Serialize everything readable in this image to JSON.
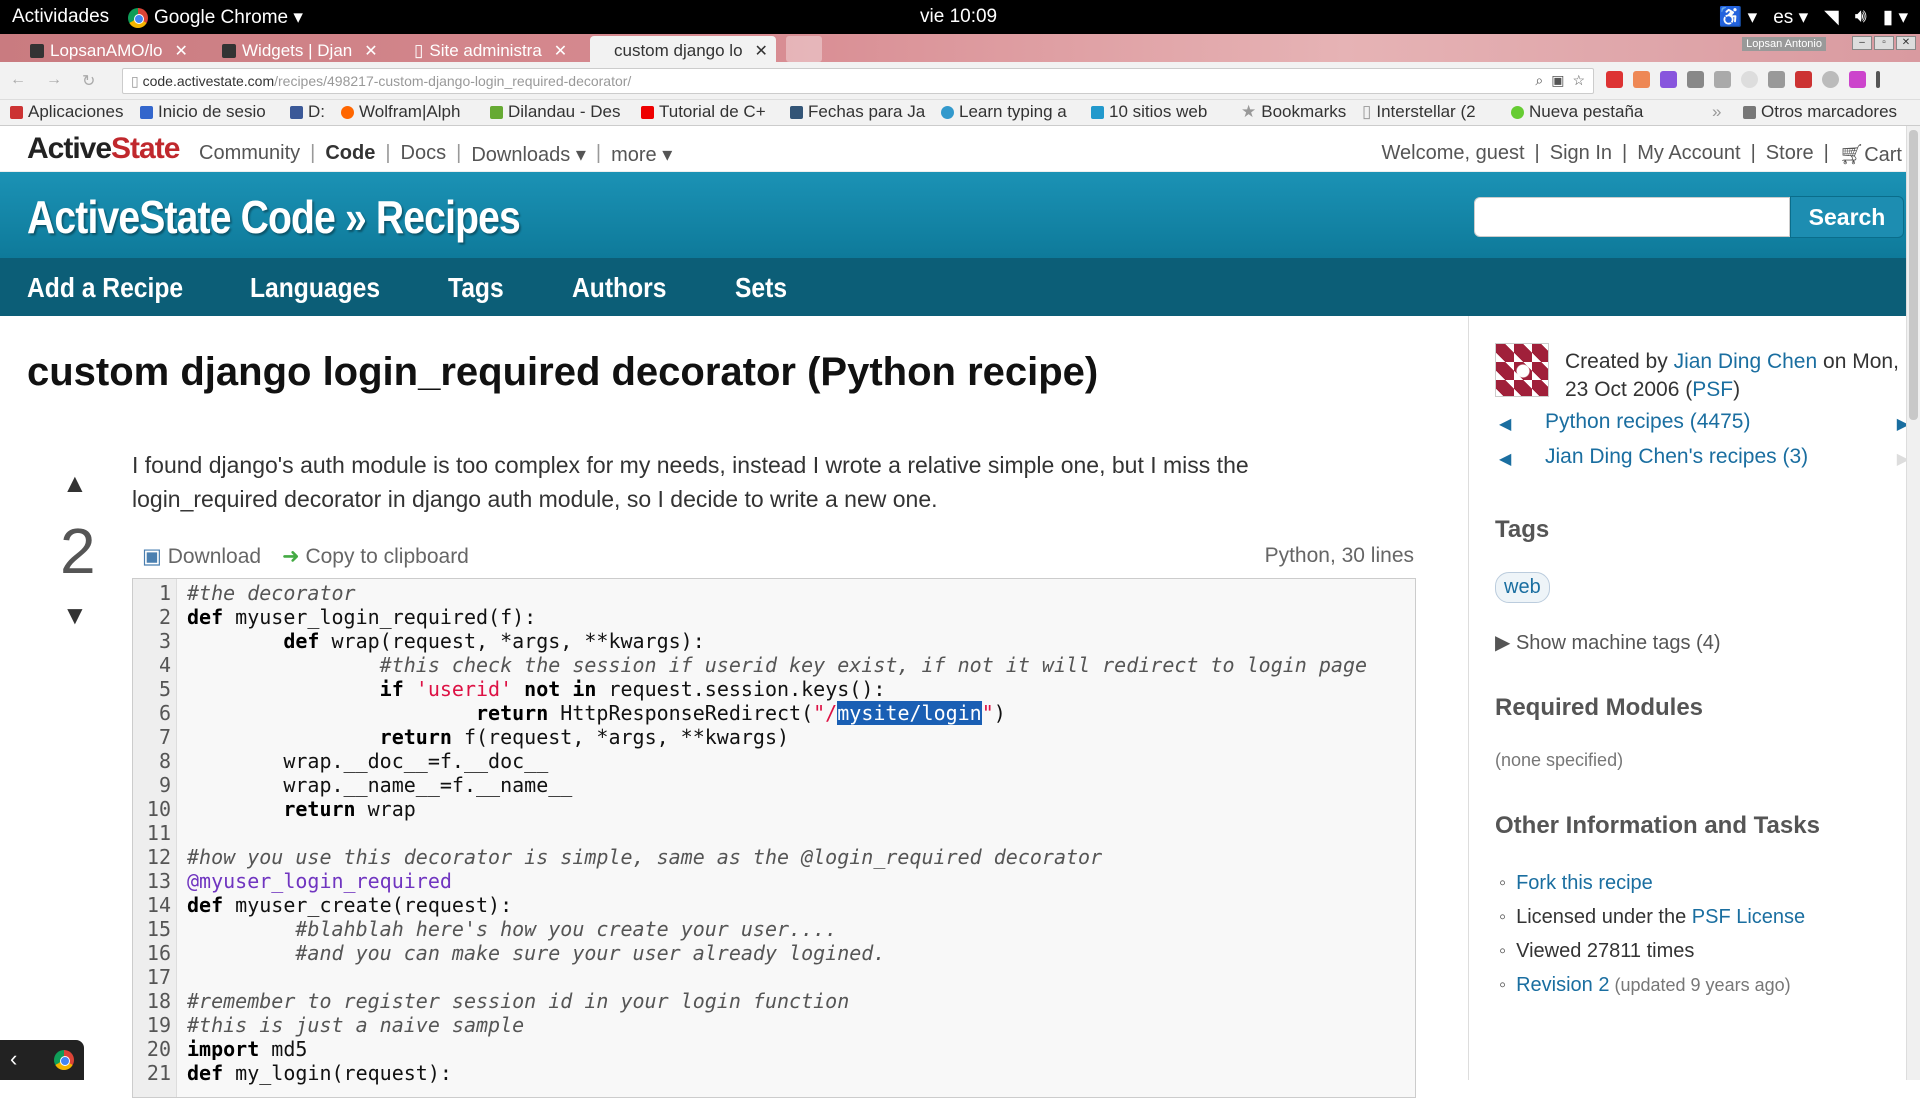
{
  "topbar": {
    "activities": "Actividades",
    "app": "Google Chrome ▾",
    "clock": "vie 10:09",
    "lang": "es ▾"
  },
  "tabs": [
    "LopsanAMO/lo",
    "Widgets | Djan",
    "Site administra",
    "custom django lo"
  ],
  "user_badge": "Lopsan Antonio",
  "url": {
    "host": "code.activestate.com",
    "path": "/recipes/498217-custom-django-login_required-decorator/"
  },
  "bookmarks": [
    "Aplicaciones",
    "Inicio de sesio",
    "D:",
    "Wolfram|Alph",
    "Dilandau - Des",
    "Tutorial de C+",
    "Fechas para Ja",
    "Learn typing a",
    "10 sitios web",
    "Bookmarks",
    "Interstellar (2",
    "Nueva pestaña",
    "Otros marcadores"
  ],
  "brand": {
    "logo_a": "Active",
    "logo_b": "State"
  },
  "topnav": {
    "community": "Community",
    "code": "Code",
    "docs": "Docs",
    "downloads": "Downloads ▾",
    "more": "more ▾",
    "welcome": "Welcome, guest",
    "signin": "Sign In",
    "account": "My Account",
    "store": "Store",
    "cart": "Cart",
    "sep": "|"
  },
  "banner": {
    "title": "ActiveState Code » Recipes",
    "search": "Search"
  },
  "subnav": [
    "Add a Recipe",
    "Languages",
    "Tags",
    "Authors",
    "Sets"
  ],
  "recipe": {
    "title": "custom django login_required decorator (Python recipe)",
    "votes": "2",
    "description": "I found django's auth module is too complex for my needs, instead I wrote a relative simple one, but I miss the login_required decorator in django auth module, so I decide to write a new one.",
    "download": "Download",
    "copy": "Copy to clipboard",
    "info": "Python, 30 lines"
  },
  "code_lines": [
    "#the decorator",
    "def myuser_login_required(f):",
    "        def wrap(request, *args, **kwargs):",
    "                #this check the session if userid key exist, if not it will redirect to login page",
    "                if 'userid' not in request.session.keys():",
    "                        return HttpResponseRedirect(\"/mysite/login\")",
    "                return f(request, *args, **kwargs)",
    "        wrap.__doc__=f.__doc__",
    "        wrap.__name__=f.__name__",
    "        return wrap",
    "",
    "#how you use this decorator is simple, same as the @login_required decorator",
    "@myuser_login_required",
    "def myuser_create(request):",
    "         #blahblah here's how you create your user....",
    "         #and you can make sure your user already logined.",
    "",
    "#remember to register session id in your login function",
    "#this is just a naive sample",
    "import md5",
    "def my_login(request):"
  ],
  "sidebar": {
    "created_by": "Created by",
    "author": "Jian Ding Chen",
    "on": "on",
    "date": "Mon, 23 Oct 2006 (",
    "license_short": "PSF",
    "date_end": ")",
    "py_recipes": "Python recipes (4475)",
    "author_recipes": "Jian Ding Chen's recipes (3)",
    "tags_h": "Tags",
    "tag": "web",
    "machine": "▶ Show machine tags (4)",
    "req_h": "Required Modules",
    "req_none": "(none specified)",
    "other_h": "Other Information and Tasks",
    "fork": "Fork this recipe",
    "licensed": "Licensed under the ",
    "license": "PSF License",
    "viewed": "Viewed 27811 times",
    "revision": "Revision 2",
    "revision_note": " (updated 9 years ago)"
  }
}
